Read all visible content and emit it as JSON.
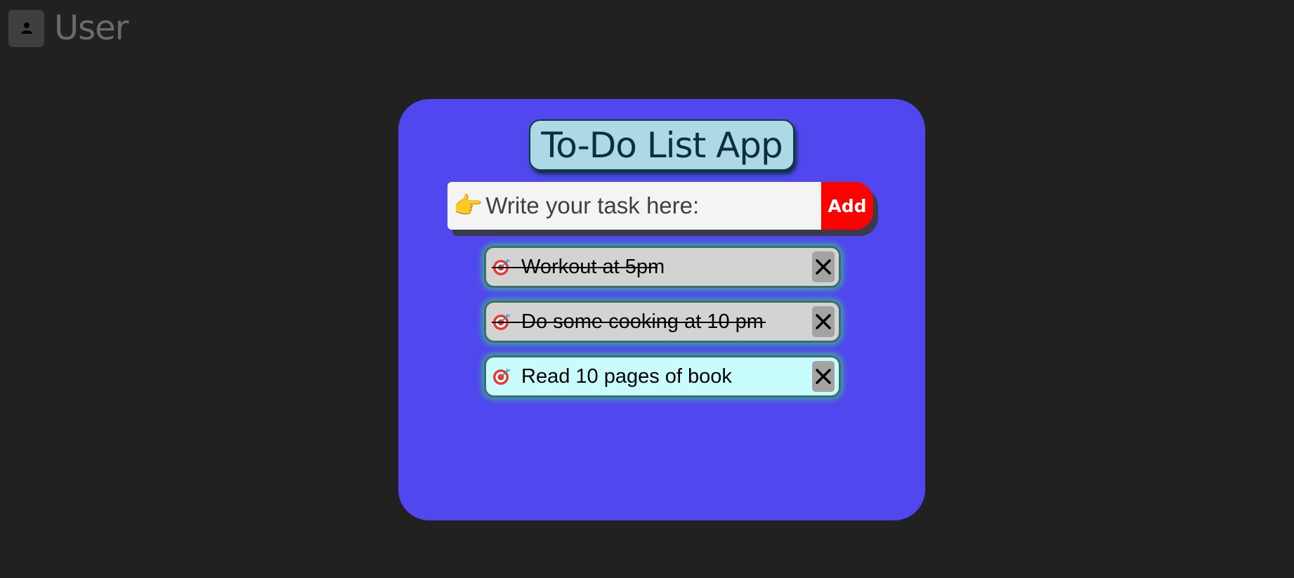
{
  "user": {
    "name": "User",
    "avatar_icon": "person-icon"
  },
  "app": {
    "title": "To-Do List App",
    "input": {
      "placeholder": "Write your task here:",
      "value": "",
      "icon": "pointing-hand-icon"
    },
    "add_label": "Add"
  },
  "tasks": [
    {
      "text": "Workout at 5pm",
      "done": true,
      "icon": "target-icon"
    },
    {
      "text": "Do some cooking at 10 pm",
      "done": true,
      "icon": "target-icon"
    },
    {
      "text": "Read 10 pages of book",
      "done": false,
      "icon": "target-icon"
    }
  ],
  "colors": {
    "background": "#202120",
    "card": "#5048ee",
    "title_bg": "#add8e6",
    "add_button": "#ff0000",
    "task_done": "#d3d3d3",
    "task_open": "#c9fdfd",
    "task_glow": "#3fa9a0"
  }
}
